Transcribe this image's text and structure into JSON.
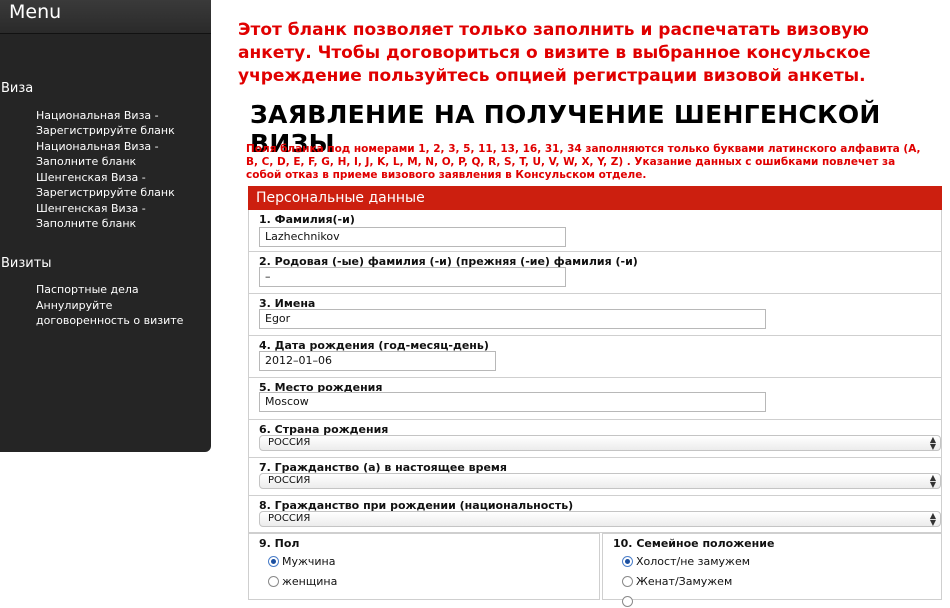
{
  "sidebar": {
    "menu_title": "Menu",
    "sections": [
      {
        "title": "Виза",
        "links": [
          [
            "Национальная Виза -",
            "Зарегистрируйте бланк"
          ],
          [
            "Национальная Виза -",
            "Заполните бланк"
          ],
          [
            "Шенгенская Виза -",
            "Зарегистрируйте бланк"
          ],
          [
            "Шенгенская Виза -",
            "Заполните бланк"
          ]
        ]
      },
      {
        "title": "Визиты",
        "links": [
          [
            "Паспортные дела"
          ],
          [
            "Аннулируйте",
            "договоренность о визите"
          ]
        ]
      }
    ]
  },
  "notice": "Этот бланк позволяет только заполнить и распечатать визовую анкету. Чтобы договориться о визите в выбранное консульское учреждение пользуйтесь опцией регистрации визовой анкеты.",
  "form_title": "ЗАЯВЛЕНИЕ НА ПОЛУЧЕНИЕ ШЕНГЕНСКОЙ ВИЗЫ",
  "rule_text": "Поля бланка под номерами 1, 2, 3, 5, 11, 13, 16, 31, 34 заполняются только буквами латинского алфавита (A, B, C, D, E, F, G, H, I, J, K, L, M, N, O, P, Q, R, S, T, U, V, W, X, Y, Z) . Указание данных с ошибками повлечет за собой отказ в приеме визового заявления в Консульском отделе.",
  "section_title": "Персональные данные",
  "fields": {
    "surname": {
      "label": "1. Фамилия(-и)",
      "value": "Lazhechnikov"
    },
    "birth_surname": {
      "label": "2. Родовая (-ые) фамилия (-и) (прежняя (-ие) фамилия (-и)",
      "value": "–"
    },
    "first_names": {
      "label": "3. Имена",
      "value": "Egor"
    },
    "birth_date": {
      "label": "4. Дата рождения (год-месяц-день)",
      "value": "2012–01–06"
    },
    "birth_place": {
      "label": "5. Место рождения",
      "value": "Moscow"
    },
    "birth_country": {
      "label": "6. Страна рождения",
      "value": "РОССИЯ"
    },
    "citizenship": {
      "label": "7. Гражданство (а) в настоящее время",
      "value": "РОССИЯ"
    },
    "citizenship_birth": {
      "label": "8. Гражданство при рождении (национальность)",
      "value": "РОССИЯ"
    }
  },
  "sex": {
    "label": "9. Пол",
    "options": [
      {
        "label": "Мужчина",
        "selected": true
      },
      {
        "label": "женщина",
        "selected": false
      }
    ]
  },
  "marital": {
    "label": "10. Семейное положение",
    "options": [
      {
        "label": "Холост/не замужем",
        "selected": true
      },
      {
        "label": "Женат/Замужем",
        "selected": false
      }
    ]
  },
  "colors": {
    "accent_red": "#cc1f0f",
    "notice_red": "#e00000",
    "sidebar_bg": "#252525"
  }
}
